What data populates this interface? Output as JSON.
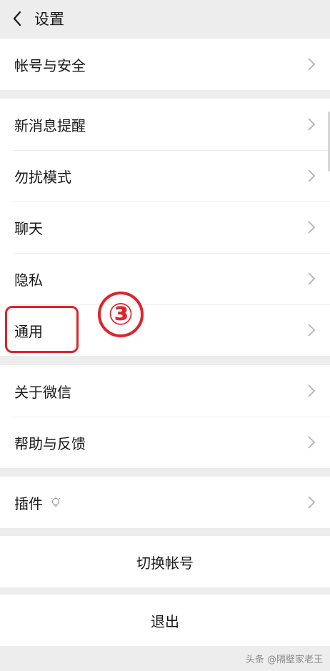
{
  "header": {
    "title": "设置",
    "back_icon": "chevron-left-icon"
  },
  "groups": [
    {
      "items": [
        {
          "label": "帐号与安全"
        }
      ]
    },
    {
      "items": [
        {
          "label": "新消息提醒"
        },
        {
          "label": "勿扰模式"
        },
        {
          "label": "聊天"
        },
        {
          "label": "隐私"
        },
        {
          "label": "通用"
        }
      ]
    },
    {
      "items": [
        {
          "label": "关于微信"
        },
        {
          "label": "帮助与反馈"
        }
      ]
    },
    {
      "items": [
        {
          "label": "插件",
          "icon": "bulb-icon"
        }
      ]
    }
  ],
  "actions": {
    "switch_account": "切换帐号",
    "logout": "退出"
  },
  "annotation": {
    "number": "③",
    "color": "#e1222a"
  },
  "watermark": "头条 @隔壁家老王"
}
